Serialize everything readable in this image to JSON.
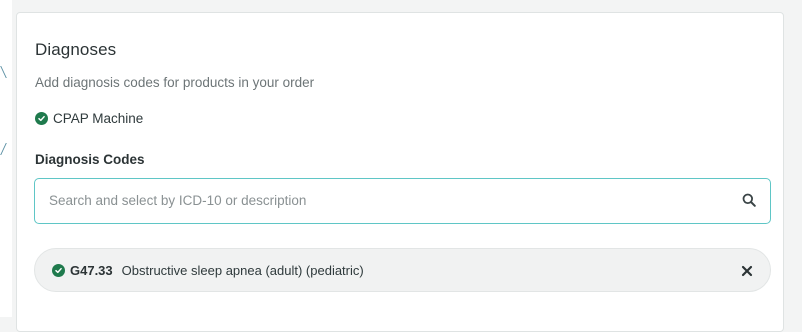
{
  "panel": {
    "title": "Diagnoses",
    "subtitle": "Add diagnosis codes for products in your order"
  },
  "product": {
    "name": "CPAP Machine",
    "status_icon": "check-circle-icon",
    "status_color": "#1f7a4d"
  },
  "diagnosis_codes": {
    "label": "Diagnosis Codes",
    "search": {
      "placeholder": "Search and select by ICD-10 or description",
      "value": "",
      "icon": "search-icon"
    },
    "selected": [
      {
        "code": "G47.33",
        "description": "Obstructive sleep apnea (adult) (pediatric)",
        "status_icon": "check-circle-icon",
        "remove_icon": "close-icon"
      }
    ]
  },
  "colors": {
    "accent": "#5fc6c6",
    "success": "#1f7a4d",
    "text": "#2f3a3c",
    "muted": "#6d7577"
  }
}
